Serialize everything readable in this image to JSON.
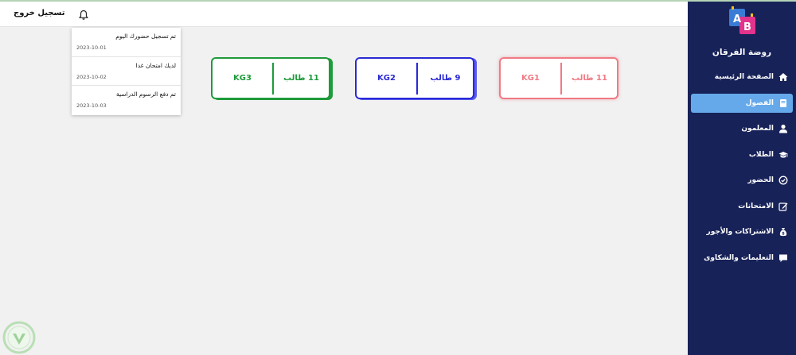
{
  "topbar": {
    "logout_label": "تسجيل خروج"
  },
  "notifications": [
    {
      "text": "تم تسجيل حضورك اليوم",
      "date": "2023-10-01"
    },
    {
      "text": "لديك امتحان غدا",
      "date": "2023-10-02"
    },
    {
      "text": "تم دفع الرسوم الدراسية",
      "date": "2023-10-03"
    }
  ],
  "classes": [
    {
      "name": "KG3",
      "count": "11 طالب",
      "color": "#1e9b3a"
    },
    {
      "name": "KG2",
      "count": "9 طالب",
      "color": "#2a2ad4"
    },
    {
      "name": "KG1",
      "count": "11 طالب",
      "color": "#f07a84"
    }
  ],
  "sidebar": {
    "school_name": "روضة الفرقان",
    "logo_letters": [
      "A",
      "B"
    ],
    "items": [
      {
        "label": "الصفحة الرئيسية",
        "icon": "home-icon"
      },
      {
        "label": "الفصول",
        "icon": "book-icon"
      },
      {
        "label": "المعلمون",
        "icon": "user-icon"
      },
      {
        "label": "الطلاب",
        "icon": "graduation-cap-icon"
      },
      {
        "label": "الحضور",
        "icon": "check-circle-icon"
      },
      {
        "label": "الامتحانات",
        "icon": "edit-icon"
      },
      {
        "label": "الاشتراكات والأجور",
        "icon": "money-bag-icon"
      },
      {
        "label": "التعليمات والشكاوى",
        "icon": "comment-icon"
      }
    ],
    "active_index": 1
  },
  "colors": {
    "sidebar_bg": "#172258",
    "active_item": "#65a9ea",
    "page_bg": "#f1f1f1"
  }
}
